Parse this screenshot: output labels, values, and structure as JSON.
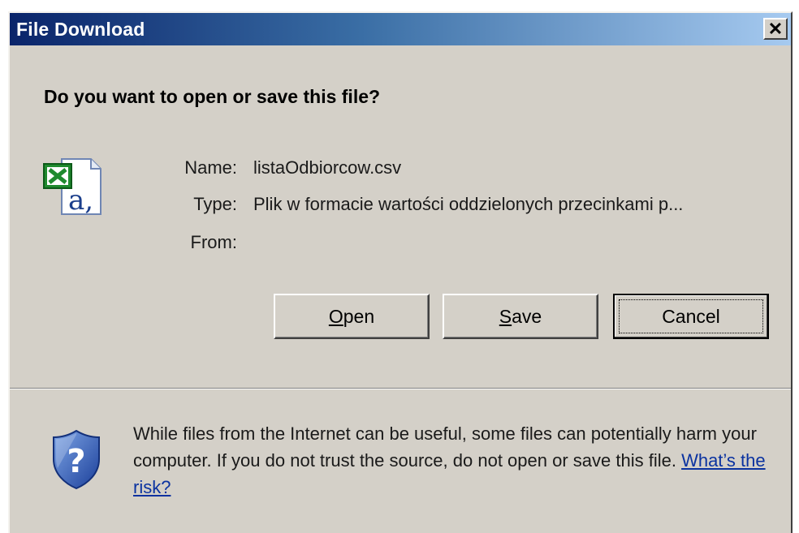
{
  "window": {
    "title": "File Download",
    "close_label": "✕"
  },
  "prompt": {
    "question": "Do you want to open or save this file?"
  },
  "file": {
    "icon": "excel-csv-file-icon",
    "name_label": "Name:",
    "name_value": "listaOdbiorcow.csv",
    "type_label": "Type:",
    "type_value": "Plik w formacie wartości oddzielonych przecinkami p...",
    "from_label": "From:",
    "from_value": ""
  },
  "buttons": {
    "open_mnemonic": "O",
    "open_rest": "pen",
    "save_mnemonic": "S",
    "save_rest": "ave",
    "cancel_label": "Cancel"
  },
  "warning": {
    "icon": "security-shield-question-icon",
    "text": "While files from the Internet can be useful, some files can potentially harm your computer. If you do not trust the source, do not open or save this file.",
    "link_text": "What’s the risk?"
  },
  "colors": {
    "title_gradient_start": "#0a246a",
    "title_gradient_end": "#a6caf0",
    "dialog_face": "#d4d0c8",
    "link": "#0a32a0"
  }
}
